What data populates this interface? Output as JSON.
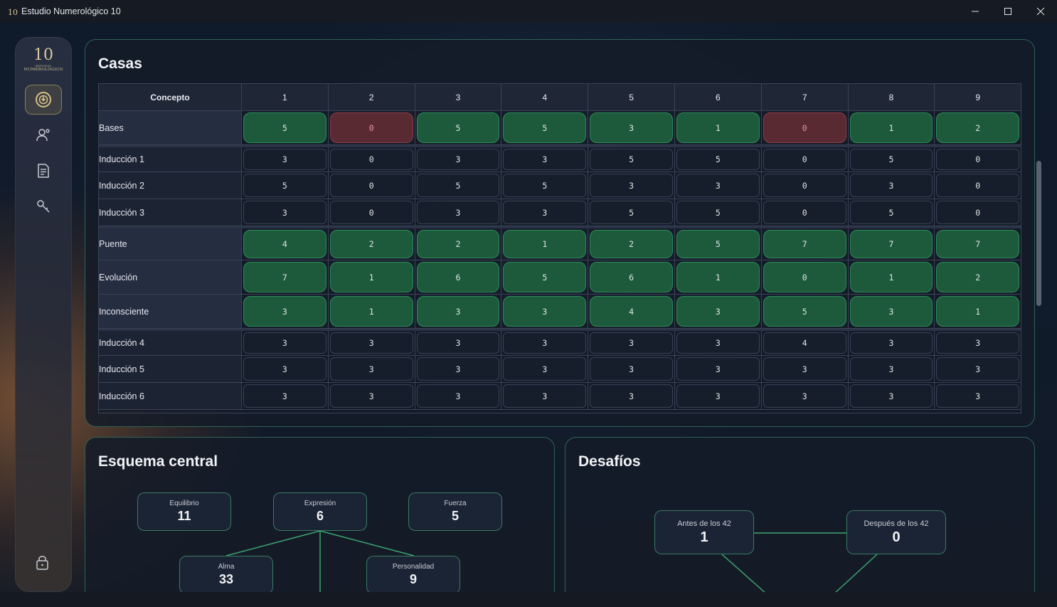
{
  "window": {
    "title": "Estudio Numerológico 10",
    "app_icon": "app-logo-icon",
    "controls": [
      "minimize-icon",
      "maximize-icon",
      "close-icon"
    ]
  },
  "sidebar": {
    "logo_number": "10",
    "logo_text_line1": "ESTUDIO",
    "logo_text_line2": "NUMEROLÓGICO",
    "items": [
      {
        "icon": "numerology-icon",
        "active": true
      },
      {
        "icon": "users-icon",
        "active": false
      },
      {
        "icon": "document-icon",
        "active": false
      },
      {
        "icon": "key-icon",
        "active": false
      }
    ],
    "bottom_icon": "lock-icon"
  },
  "casas": {
    "title": "Casas",
    "header": [
      "Concepto",
      "1",
      "2",
      "3",
      "4",
      "5",
      "6",
      "7",
      "8",
      "9"
    ],
    "rows": [
      {
        "label": "Bases",
        "style": "pill",
        "values": [
          "5",
          "0",
          "5",
          "5",
          "3",
          "1",
          "0",
          "1",
          "2"
        ],
        "states": [
          "green",
          "red",
          "green",
          "green",
          "green",
          "green",
          "red",
          "green",
          "green"
        ]
      },
      {
        "label": "Inducción 1",
        "style": "plain",
        "values": [
          "3",
          "0",
          "3",
          "3",
          "5",
          "5",
          "0",
          "5",
          "0"
        ]
      },
      {
        "label": "Inducción 2",
        "style": "plain",
        "values": [
          "5",
          "0",
          "5",
          "5",
          "3",
          "3",
          "0",
          "3",
          "0"
        ]
      },
      {
        "label": "Inducción 3",
        "style": "plain",
        "values": [
          "3",
          "0",
          "3",
          "3",
          "5",
          "5",
          "0",
          "5",
          "0"
        ]
      },
      {
        "label": "Puente",
        "style": "pill",
        "values": [
          "4",
          "2",
          "2",
          "1",
          "2",
          "5",
          "7",
          "7",
          "7"
        ],
        "states": [
          "green",
          "green",
          "green",
          "green",
          "green",
          "green",
          "green",
          "green",
          "green"
        ]
      },
      {
        "label": "Evolución",
        "style": "pill",
        "values": [
          "7",
          "1",
          "6",
          "5",
          "6",
          "1",
          "0",
          "1",
          "2"
        ],
        "states": [
          "green",
          "green",
          "green",
          "green",
          "green",
          "green",
          "green",
          "green",
          "green"
        ]
      },
      {
        "label": "Inconsciente",
        "style": "pill",
        "values": [
          "3",
          "1",
          "3",
          "3",
          "4",
          "3",
          "5",
          "3",
          "1"
        ],
        "states": [
          "green",
          "green",
          "green",
          "green",
          "green",
          "green",
          "green",
          "green",
          "green"
        ]
      },
      {
        "label": "Inducción 4",
        "style": "plain",
        "values": [
          "3",
          "3",
          "3",
          "3",
          "3",
          "3",
          "4",
          "3",
          "3"
        ]
      },
      {
        "label": "Inducción 5",
        "style": "plain",
        "values": [
          "3",
          "3",
          "3",
          "3",
          "3",
          "3",
          "3",
          "3",
          "3"
        ]
      },
      {
        "label": "Inducción 6",
        "style": "plain",
        "values": [
          "3",
          "3",
          "3",
          "3",
          "3",
          "3",
          "3",
          "3",
          "3"
        ]
      }
    ],
    "colors": {
      "green": "#1d5a3c",
      "red": "#5a2a33",
      "accent_border": "#46a078"
    }
  },
  "esquema": {
    "title": "Esquema central",
    "nodes": {
      "equilibrio": {
        "label": "Equilibrio",
        "value": "11"
      },
      "expresion": {
        "label": "Expresión",
        "value": "6"
      },
      "fuerza": {
        "label": "Fuerza",
        "value": "5"
      },
      "alma": {
        "label": "Alma",
        "value": "33"
      },
      "personalidad": {
        "label": "Personalidad",
        "value": "9"
      }
    }
  },
  "desafios": {
    "title": "Desafíos",
    "nodes": {
      "antes": {
        "label": "Antes de los 42",
        "value": "1"
      },
      "despues": {
        "label": "Después de los 42",
        "value": "0"
      }
    }
  }
}
